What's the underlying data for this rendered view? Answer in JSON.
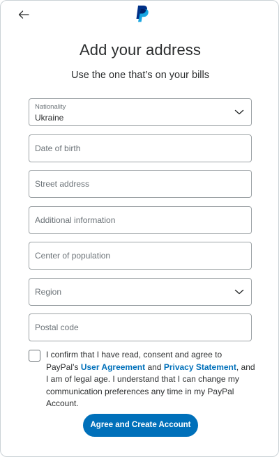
{
  "header": {
    "back_icon": "arrow-left-icon",
    "logo_icon": "paypal-logo-icon"
  },
  "title": "Add your address",
  "subtitle": "Use the one that’s on your bills",
  "form": {
    "nationality": {
      "label": "Nationality",
      "value": "Ukraine"
    },
    "date_of_birth": {
      "placeholder": "Date of birth"
    },
    "street_address": {
      "placeholder": "Street address"
    },
    "additional_information": {
      "placeholder": "Additional information"
    },
    "center_of_population": {
      "placeholder": "Center of population"
    },
    "region": {
      "placeholder": "Region"
    },
    "postal_code": {
      "placeholder": "Postal code"
    }
  },
  "consent": {
    "checked": false,
    "text_1": "I confirm that I have read, consent and agree to PayPal’s",
    "link_user_agreement": "User Agreement",
    "text_and": "and",
    "link_privacy_statement": "Privacy Statement",
    "text_2": ", and I am of legal age. I understand that I can change my communication preferences any time in my PayPal Account."
  },
  "submit_button": "Agree and Create Account",
  "colors": {
    "accent": "#0070ba",
    "border": "#9da3a6",
    "text": "#2c2e2f",
    "placeholder": "#6c7378",
    "logo_dark": "#003087",
    "logo_light": "#009cde"
  }
}
